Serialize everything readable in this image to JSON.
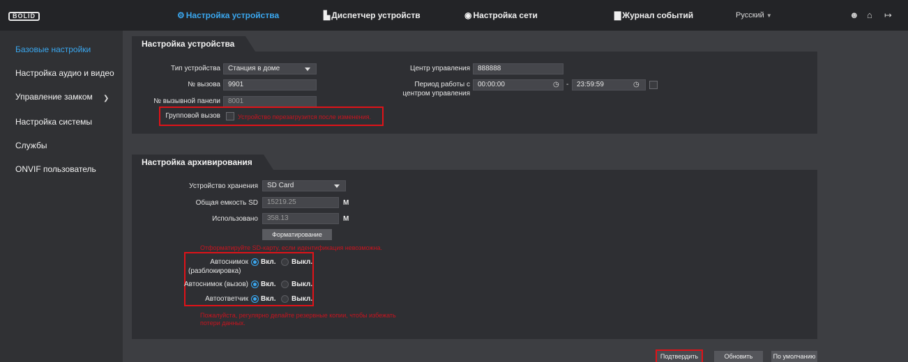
{
  "header": {
    "logo": "BOLID",
    "nav": [
      {
        "label": "Настройка устройства",
        "icon": "gear-icon",
        "glyph": "⚙"
      },
      {
        "label": "Диспетчер устройств",
        "icon": "device-list-icon",
        "glyph": "▙"
      },
      {
        "label": "Настройка сети",
        "icon": "globe-icon",
        "glyph": "◉"
      },
      {
        "label": "Журнал событий",
        "icon": "log-icon",
        "glyph": "▇"
      }
    ],
    "language": "Русский",
    "colors": {
      "accent": "#3aa7ef",
      "highlight": "#e11218"
    }
  },
  "sidebar": {
    "items": [
      {
        "label": "Базовые настройки"
      },
      {
        "label": "Настройка аудио и видео"
      },
      {
        "label": "Управление замком"
      },
      {
        "label": "Настройка системы"
      },
      {
        "label": "Службы"
      },
      {
        "label": "ONVIF пользователь"
      }
    ]
  },
  "device_settings": {
    "title": "Настройка устройства",
    "device_type_label": "Тип устройства",
    "device_type_value": "Станция в доме",
    "call_no_label": "№ вызова",
    "call_no_value": "9901",
    "panel_no_label": "№ вызывной панели",
    "panel_no_value": "8001",
    "group_call_label": "Групповой вызов",
    "group_call_note": "Устройство перезагрузится после изменения.",
    "control_center_label": "Центр управления",
    "control_center_value": "888888",
    "work_period_label_1": "Период работы с",
    "work_period_label_2": "центром управления",
    "period_start": "00:00:00",
    "period_sep": "-",
    "period_end": "23:59:59"
  },
  "archive_settings": {
    "title": "Настройка архивирования",
    "storage_label": "Устройство хранения",
    "storage_value": "SD Card",
    "capacity_label": "Общая емкость SD",
    "capacity_value": "15219.25",
    "capacity_unit": "M",
    "used_label": "Использовано",
    "used_value": "358.13",
    "used_unit": "M",
    "format_button": "Форматирование",
    "format_note": "Отформатируйте SD-карту, если идентификация невозможна.",
    "auto_snapshot_unlock_1": "Автоснимок",
    "auto_snapshot_unlock_2": "(разблокировка)",
    "auto_snapshot_call": "Автоснимок (вызов)",
    "auto_answer": "Автоответчик",
    "on_label": "Вкл.",
    "off_label": "Выкл.",
    "backup_note_1": "Пожалуйста, регулярно делайте резервные копии, чтобы избежать",
    "backup_note_2": "потери данных."
  },
  "footer": {
    "confirm": "Подтвердить",
    "refresh": "Обновить",
    "default": "По умолчанию"
  }
}
